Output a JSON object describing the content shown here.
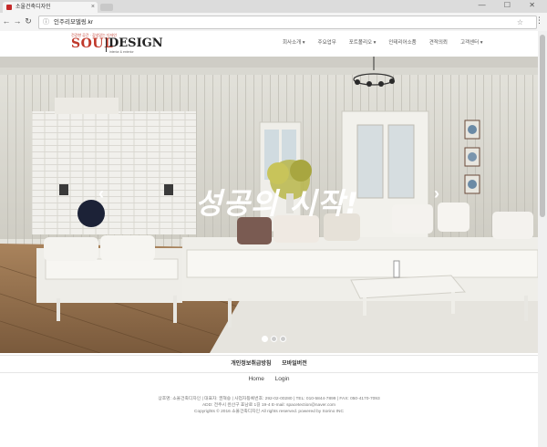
{
  "browser": {
    "tab_title": "소울건축디자인",
    "url": "인주리모델링.kr",
    "close_glyph": "×",
    "window_controls": "— ☐ ✕"
  },
  "logo": {
    "tagline": "건강한 공간 · 감성있는 디자인",
    "brand_left": "SOUL",
    "brand_right": "DESIGN",
    "subtitle": "interior & exterior"
  },
  "nav": [
    {
      "label": "회사소개 ▾"
    },
    {
      "label": "주요업무"
    },
    {
      "label": "포트폴리오 ▾"
    },
    {
      "label": "인테리어소품"
    },
    {
      "label": "견적의뢰"
    },
    {
      "label": "고객센터 ▾"
    }
  ],
  "hero": {
    "headline": "성공의 시작!",
    "prev_arrow": "‹",
    "next_arrow": "›",
    "slide_count": 3,
    "active_slide": 1
  },
  "footer_links": [
    "개인정보취급방침",
    "모바일버전"
  ],
  "bottom_nav": [
    "Home",
    "Login"
  ],
  "company_info": [
    "상호명: 소울건축디자인 | 대표자: 권혁승 | 사업자등록번호: 292-02-00280 | TEL: 010-5844-7899 | FAX: 050-4170-7093",
    "ADD: 전주시 완산구 효남로 1길 19-4 E-mail: spacetection@naver.com",
    "Copyrights © 2016 소울건축디자인 All rights reserved. powered by Sorino INC"
  ]
}
